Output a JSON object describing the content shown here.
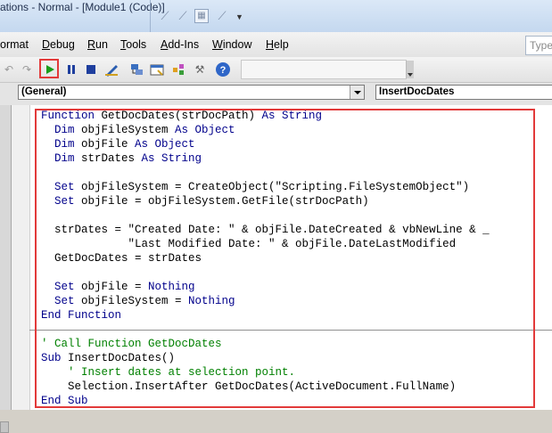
{
  "window": {
    "title": "ations - Normal - [Module1 (Code)]"
  },
  "menu": {
    "items": [
      {
        "label": "ormat",
        "underline_index": -1
      },
      {
        "label": "Debug",
        "underline_index": 0
      },
      {
        "label": "Run",
        "underline_index": 0
      },
      {
        "label": "Tools",
        "underline_index": 0
      },
      {
        "label": "Add-Ins",
        "underline_index": 0
      },
      {
        "label": "Window",
        "underline_index": 0
      },
      {
        "label": "Help",
        "underline_index": 0
      }
    ],
    "help_placeholder": "Type"
  },
  "toolbar": {
    "buttons": [
      "undo-icon",
      "redo-icon",
      "run-icon",
      "break-icon",
      "reset-icon",
      "design-mode-icon",
      "project-explorer-icon",
      "properties-icon",
      "object-browser-icon",
      "toolbox-icon",
      "help-icon"
    ],
    "colors": {
      "run": "#1a9e1a",
      "break": "#1f3f9e",
      "reset": "#1f3f9e",
      "highlight": "#e23a3a"
    }
  },
  "object_dropdown": {
    "value": "(General)"
  },
  "procedure_dropdown": {
    "value": "InsertDocDates"
  },
  "code": {
    "lines": [
      {
        "kw": "Function",
        "rest": " GetDocDates(strDocPath) ",
        "kw2": "As String",
        "rest2": ""
      },
      {
        "kw": "  Dim",
        "rest": " objFileSystem ",
        "kw2": "As Object",
        "rest2": ""
      },
      {
        "kw": "  Dim",
        "rest": " objFile ",
        "kw2": "As Object",
        "rest2": ""
      },
      {
        "kw": "  Dim",
        "rest": " strDates ",
        "kw2": "As String",
        "rest2": ""
      },
      {
        "kw": "",
        "rest": "",
        "kw2": "",
        "rest2": ""
      },
      {
        "kw": "  Set",
        "rest": " objFileSystem = CreateObject(\"Scripting.FileSystemObject\")",
        "kw2": "",
        "rest2": ""
      },
      {
        "kw": "  Set",
        "rest": " objFile = objFileSystem.GetFile(strDocPath)",
        "kw2": "",
        "rest2": ""
      },
      {
        "kw": "",
        "rest": "",
        "kw2": "",
        "rest2": ""
      },
      {
        "kw": "",
        "rest": "  strDates = \"Created Date: \" & objFile.DateCreated & vbNewLine & _",
        "kw2": "",
        "rest2": ""
      },
      {
        "kw": "",
        "rest": "             \"Last Modified Date: \" & objFile.DateLastModified",
        "kw2": "",
        "rest2": ""
      },
      {
        "kw": "",
        "rest": "  GetDocDates = strDates",
        "kw2": "",
        "rest2": ""
      },
      {
        "kw": "",
        "rest": "",
        "kw2": "",
        "rest2": ""
      },
      {
        "kw": "  Set",
        "rest": " objFile = ",
        "kw2": "Nothing",
        "rest2": ""
      },
      {
        "kw": "  Set",
        "rest": " objFileSystem = ",
        "kw2": "Nothing",
        "rest2": ""
      },
      {
        "kw": "End Function",
        "rest": "",
        "kw2": "",
        "rest2": ""
      },
      {
        "kw": "",
        "rest": "",
        "kw2": "",
        "rest2": ""
      },
      {
        "cm": "' Call Function GetDocDates"
      },
      {
        "kw": "Sub",
        "rest": " InsertDocDates()",
        "kw2": "",
        "rest2": ""
      },
      {
        "cm": "    ' Insert dates at selection point."
      },
      {
        "kw": "",
        "rest": "    Selection.InsertAfter GetDocDates(ActiveDocument.FullName)",
        "kw2": "",
        "rest2": ""
      },
      {
        "kw": "End Sub",
        "rest": "",
        "kw2": "",
        "rest2": ""
      }
    ]
  }
}
